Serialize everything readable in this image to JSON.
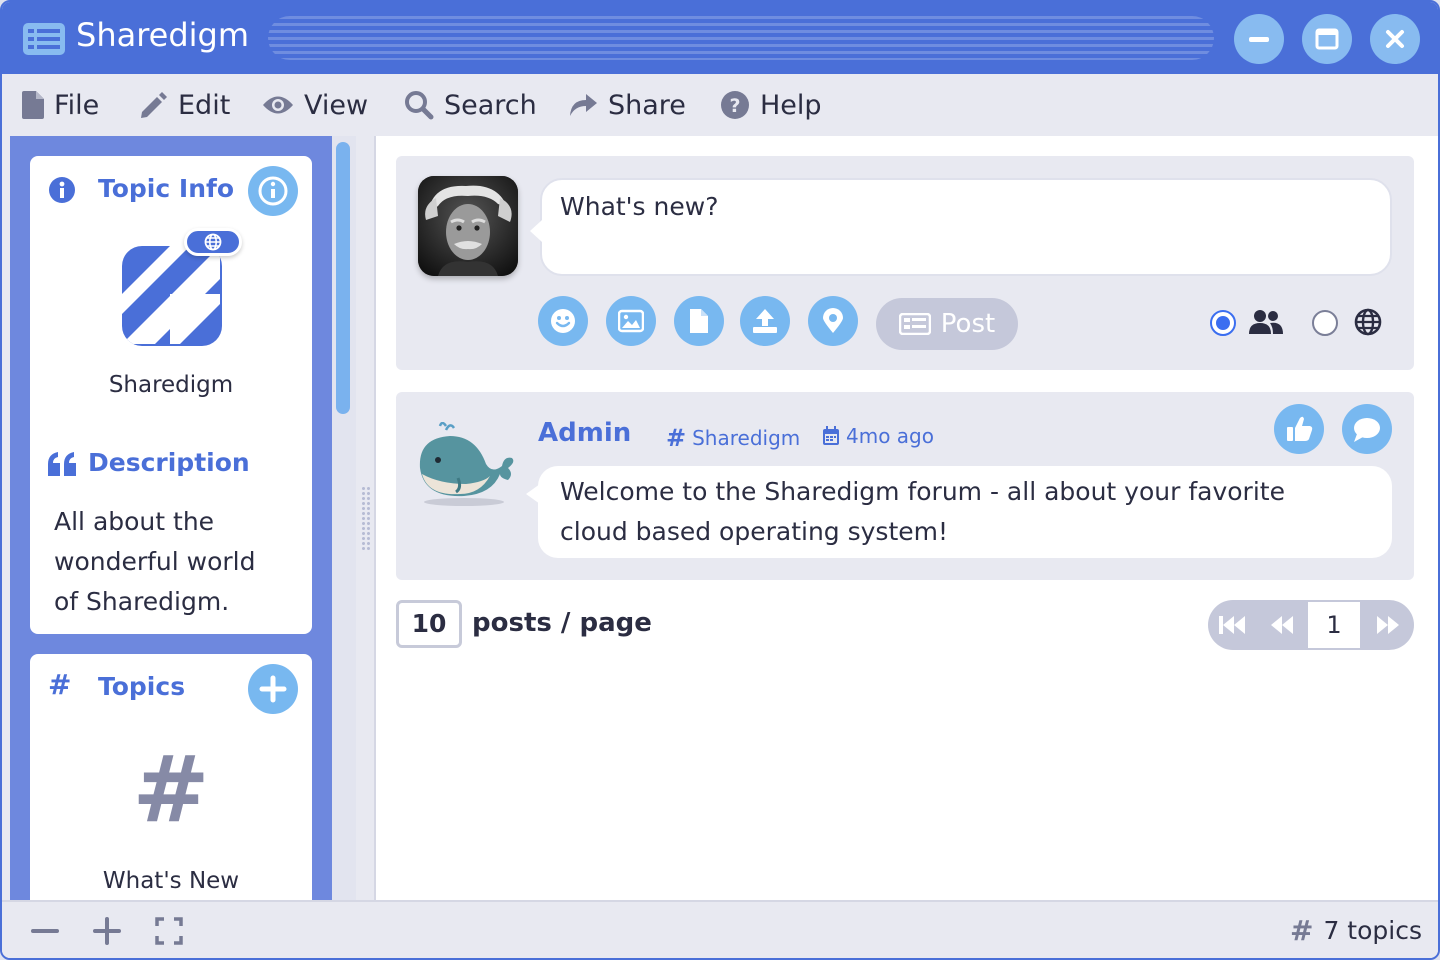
{
  "window": {
    "title": "Sharedigm",
    "colors": {
      "accent": "#4a6fd8",
      "button": "#88bbf0",
      "sidebar": "#6e88de"
    }
  },
  "menu": {
    "items": [
      {
        "label": "File",
        "icon": "file-icon"
      },
      {
        "label": "Edit",
        "icon": "pencil-icon"
      },
      {
        "label": "View",
        "icon": "eye-icon"
      },
      {
        "label": "Search",
        "icon": "search-icon"
      },
      {
        "label": "Share",
        "icon": "share-icon"
      },
      {
        "label": "Help",
        "icon": "help-icon"
      }
    ]
  },
  "sidebar": {
    "topic_info": {
      "title": "Topic Info",
      "topic_name": "Sharedigm",
      "description_title": "Description",
      "description_line1": "All about the",
      "description_line2": "wonderful world",
      "description_line3": "of Sharedigm."
    },
    "topics": {
      "title": "Topics",
      "first_topic": "What's New"
    }
  },
  "composer": {
    "placeholder": "What's new?",
    "tools": [
      "emoji-icon",
      "image-icon",
      "file-icon",
      "upload-icon",
      "location-icon"
    ],
    "post_label": "Post",
    "audience": {
      "selected": "connections"
    }
  },
  "post": {
    "author": "Admin",
    "topic": "Sharedigm",
    "time": "4mo ago",
    "text_line1": "Welcome to the Sharedigm forum - all about your favorite",
    "text_line2": "cloud based operating system!"
  },
  "pagination": {
    "per_page": "10",
    "per_page_label": "posts / page",
    "current_page": "1"
  },
  "status": {
    "topic_count": "7 topics"
  }
}
